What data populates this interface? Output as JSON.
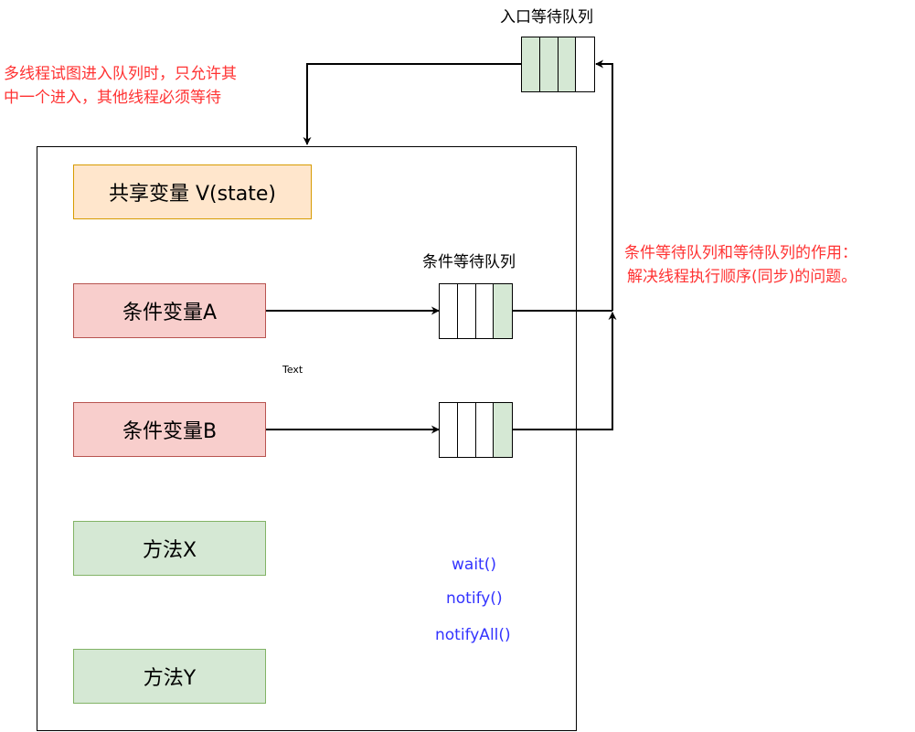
{
  "entry_queue": {
    "label": "入口等待队列"
  },
  "entry_note": {
    "line1": "多线程试图进入队列时，只允许其",
    "line2": "中一个进入，其他线程必须等待"
  },
  "shared_variable": {
    "label": "共享变量 V(state)"
  },
  "condition_queue": {
    "label": "条件等待队列"
  },
  "condition_a": {
    "label": "条件变量A"
  },
  "condition_b": {
    "label": "条件变量B"
  },
  "text_placeholder": {
    "label": "Text"
  },
  "method_x": {
    "label": "方法X"
  },
  "method_y": {
    "label": "方法Y"
  },
  "methods": {
    "wait": "wait()",
    "notify": "notify()",
    "notify_all": "notifyAll()"
  },
  "queue_note": {
    "line1": "条件等待队列和等待队列的作用：",
    "line2": "解决线程执行顺序(同步)的问题。"
  },
  "colors": {
    "shared_fill": "#ffe6cc",
    "condition_fill": "#f8cecc",
    "method_fill": "#d5e8d4",
    "note_text": "#ff3333",
    "method_text": "#3333ff"
  }
}
